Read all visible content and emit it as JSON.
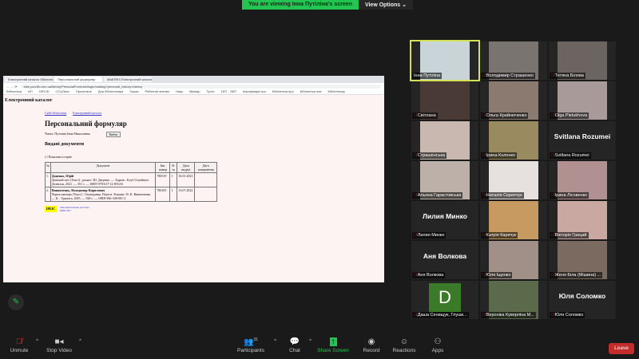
{
  "banner": {
    "viewing": "You are viewing Інна Путіліна's screen",
    "view_options": "View Options",
    "chevron": "⌄"
  },
  "browser": {
    "tabs": [
      "Електронний каталог бібліотеки",
      "Персональний формуляр",
      "#MATRIX Електронний каталог"
    ],
    "url": "irbis.yourlib.com.ua/library/PersonalFormular/login/catalog?personal_history=history",
    "bookmarks": [
      "Бібліотека",
      "ИЛ",
      "ORCID",
      "ССЦЛекс",
      "Прочитане",
      "Для бібліотекаря",
      "Зорая",
      "Рейтинги вчених",
      "Наук",
      "Міжнар",
      "Гугли",
      "1ЕП - ЭКП",
      "Інформація про",
      "Бібліотека про",
      "Бібліотека нов",
      "Бібліотекар"
    ]
  },
  "page": {
    "catalog_title": "Електронний каталог",
    "links": [
      "Сайт бібліотеки",
      "Електронний каталог"
    ],
    "title": "Персональний формуляр",
    "reader": "Читач: Путіліна Інна Миколаївна",
    "exit": "Вийти",
    "subtitle": "Видані документи",
    "checkbox": "Показати історію",
    "table": {
      "headers": [
        "№",
        "Документ",
        "Інв. номер",
        "К-ть",
        "Дата видачі",
        "Дата повернення"
      ],
      "rows": [
        {
          "n": "1.",
          "author": "Даценко, Юрій",
          "desc": "Дитячий світ [Текст] : роман / Ю. Даценко. — Харків : Клуб Сімейного Дозвілля, 2021. — 351 с. — ISBN 978-617-12-8554-6",
          "inv": "780519",
          "qty": "1",
          "issued": "16.01.2023",
          "returned": ""
        },
        {
          "n": "2.",
          "author": "Винниченко, Володимир Кирилович",
          "desc": "Чорна пантера [Текст] : Оповідання. Повісті. Романи / В. К. Винниченко. — К. : Грамота, 2005. — 928 с. — ISBN 966-349-001-2",
          "inv": "780105",
          "qty": "1",
          "issued": "13.07.2022",
          "returned": ""
        }
      ]
    },
    "footer_logo": "ІРБІС",
    "footer_links": [
      "Автоматизована система",
      "ІРБІС64+"
    ]
  },
  "participants": [
    {
      "name": "Інна Путіліна",
      "video": true,
      "color": "#c9d4d8",
      "active": true
    },
    {
      "name": "Володимир Страшенко",
      "video": true,
      "color": "#7a7470"
    },
    {
      "name": "Тетяна Білова",
      "video": true,
      "color": "#6b6460"
    },
    {
      "name": "Світлана",
      "video": true,
      "color": "#4a3a36"
    },
    {
      "name": "Ольга Крайнюченко",
      "video": true,
      "color": "#8a7a70"
    },
    {
      "name": "Olga Pletukhova",
      "video": true,
      "color": "#a99a9a"
    },
    {
      "name": "Страшенська",
      "video": true,
      "color": "#c8b8b0"
    },
    {
      "name": "Ірина Коленко",
      "video": true,
      "color": "#9a8a60"
    },
    {
      "name": "Svitlana Rozumei",
      "video": false
    },
    {
      "name": "Альона Гарастовська",
      "video": true,
      "color": "#bdb0a8"
    },
    {
      "name": "Наталія Скрипчук",
      "video": true,
      "color": "#e6e0de"
    },
    {
      "name": "Ірина Лісовенко",
      "video": true,
      "color": "#b09090"
    },
    {
      "name": "Лилия Минко",
      "video": false
    },
    {
      "name": "Катрія Карячук",
      "video": true,
      "color": "#c69a60"
    },
    {
      "name": "Вікторія Грицай",
      "video": true,
      "color": "#c8a8a0"
    },
    {
      "name": "Аня Волкова",
      "video": false
    },
    {
      "name": "Юля Іщенко",
      "video": true,
      "color": "#a09088"
    },
    {
      "name": "Женя Біла (Мішина) ...",
      "video": true,
      "color": "#7a6a60"
    },
    {
      "name": "Даша Сенищук, Глушк...",
      "video": false,
      "avatar": "D"
    },
    {
      "name": "Вероніка Куверліна М...",
      "video": true,
      "color": "#5a6a4a"
    },
    {
      "name": "Юля Соломко",
      "video": false
    }
  ],
  "toolbar": {
    "unmute": "Unmute",
    "stop_video": "Stop Video",
    "participants": "Participants",
    "participants_count": "31",
    "chat": "Chat",
    "share": "Share Screen",
    "record": "Record",
    "reactions": "Reactions",
    "apps": "Apps",
    "leave": "Leave"
  }
}
